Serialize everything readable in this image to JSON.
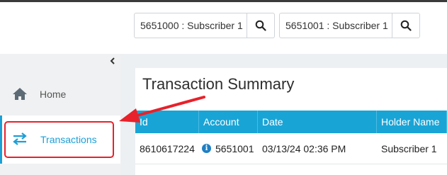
{
  "search": [
    {
      "value": "5651000 : Subscriber 1"
    },
    {
      "value": "5651001 : Subscriber 1"
    }
  ],
  "sidebar": {
    "items": [
      {
        "label": "Home",
        "icon": "home-icon"
      },
      {
        "label": "Transactions",
        "icon": "transfer-arrows-icon",
        "active": true
      }
    ]
  },
  "panel": {
    "title": "Transaction Summary"
  },
  "table": {
    "headers": [
      "Id",
      "Account",
      "Date",
      "Holder Name"
    ],
    "rows": [
      {
        "id": "8610617224",
        "account": "5651001",
        "date": "03/13/24 02:36 PM",
        "holder": "Subscriber 1"
      }
    ]
  },
  "colors": {
    "accent": "#1d9fd6",
    "annotation": "#e8212a"
  }
}
